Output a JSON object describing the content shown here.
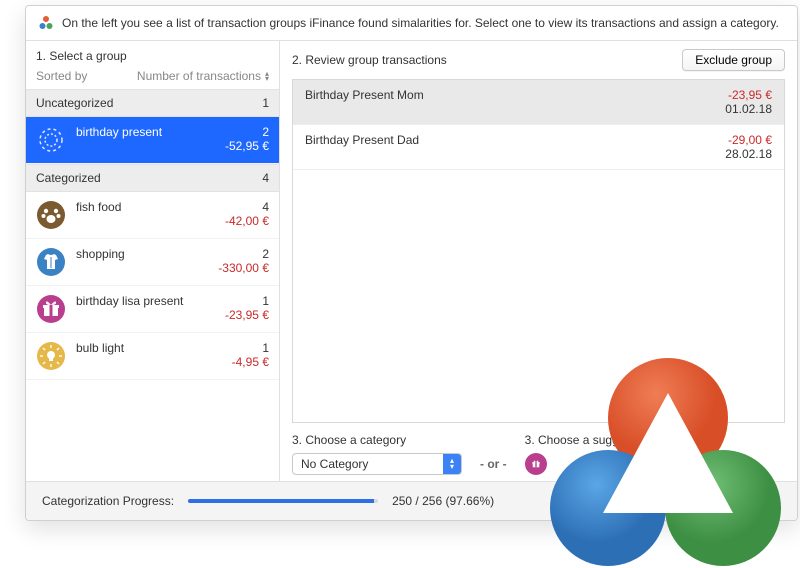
{
  "header": {
    "text": "On the left you see a list of transaction groups iFinance found simalarities for. Select one to view its transactions and assign a category."
  },
  "sidebar": {
    "title": "1. Select a group",
    "sort_label": "Sorted by",
    "sort_value": "Number of transactions",
    "sections": {
      "uncategorized": {
        "label": "Uncategorized",
        "count": "1"
      },
      "categorized": {
        "label": "Categorized",
        "count": "4"
      }
    },
    "uncategorized_items": [
      {
        "name": "birthday present",
        "count": "2",
        "amount": "-52,95 €",
        "icon": "dashed-circle",
        "selected": true
      }
    ],
    "categorized_items": [
      {
        "name": "fish food",
        "count": "4",
        "amount": "-42,00 €",
        "icon": "paw",
        "color": "#7a5a2e"
      },
      {
        "name": "shopping",
        "count": "2",
        "amount": "-330,00 €",
        "icon": "shirt",
        "color": "#3b82c4"
      },
      {
        "name": "birthday lisa present",
        "count": "1",
        "amount": "-23,95 €",
        "icon": "gift",
        "color": "#b93f8e"
      },
      {
        "name": "bulb light",
        "count": "1",
        "amount": "-4,95 €",
        "icon": "bulb",
        "color": "#e6b84a"
      }
    ]
  },
  "main": {
    "title": "2. Review group transactions",
    "exclude_label": "Exclude group",
    "transactions": [
      {
        "name": "Birthday Present Mom",
        "amount": "-23,95 €",
        "date": "01.02.18",
        "selected": true
      },
      {
        "name": "Birthday Present Dad",
        "amount": "-29,00 €",
        "date": "28.02.18",
        "selected": false
      }
    ],
    "choose_category_label": "3. Choose a category",
    "category_select_value": "No Category",
    "or_label": "- or -",
    "choose_suggested_label": "3. Choose a suggested category",
    "suggested_icon": "gift"
  },
  "footer": {
    "label": "Categorization Progress:",
    "text": "250 / 256 (97.66%)",
    "percent": 97.66
  }
}
